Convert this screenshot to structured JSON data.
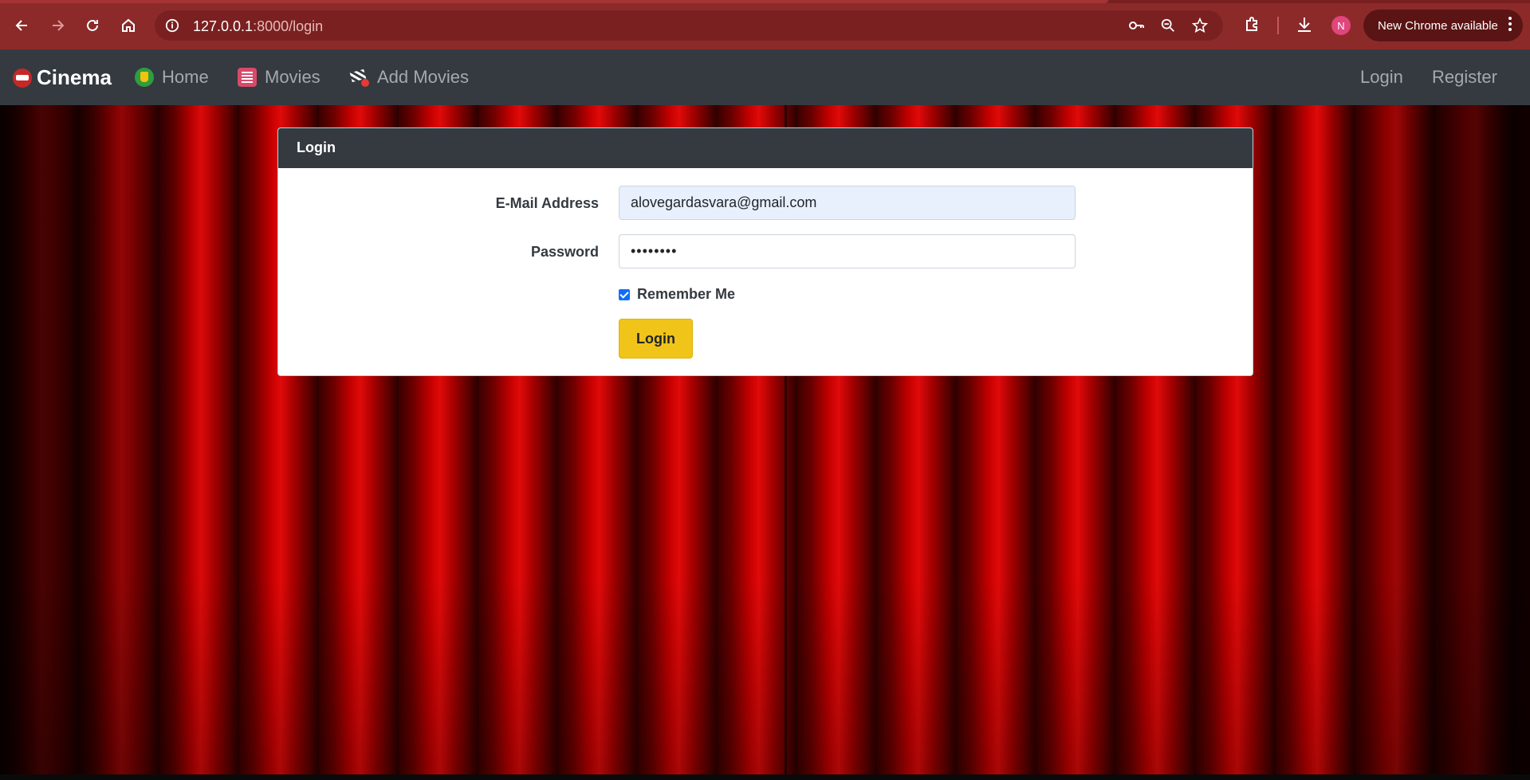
{
  "browser": {
    "url_host": "127.0.0.1",
    "url_path": ":8000/login",
    "profile_initial": "N",
    "update_label": "New Chrome available"
  },
  "navbar": {
    "brand": "Cinema",
    "links": [
      {
        "label": "Home",
        "icon": "popcorn-icon"
      },
      {
        "label": "Movies",
        "icon": "film-list-icon"
      },
      {
        "label": "Add Movies",
        "icon": "clapperboard-add-icon"
      }
    ],
    "auth": {
      "login": "Login",
      "register": "Register"
    }
  },
  "login_card": {
    "title": "Login",
    "email_label": "E-Mail Address",
    "email_value": "alovegardasvara@gmail.com",
    "password_label": "Password",
    "password_value": "••••••••",
    "remember_label": "Remember Me",
    "remember_checked": true,
    "submit_label": "Login"
  },
  "colors": {
    "navbar_bg": "#343a40",
    "accent_button": "#f0c419",
    "browser_frame": "#8c2a2a",
    "curtain": "#c40000"
  }
}
